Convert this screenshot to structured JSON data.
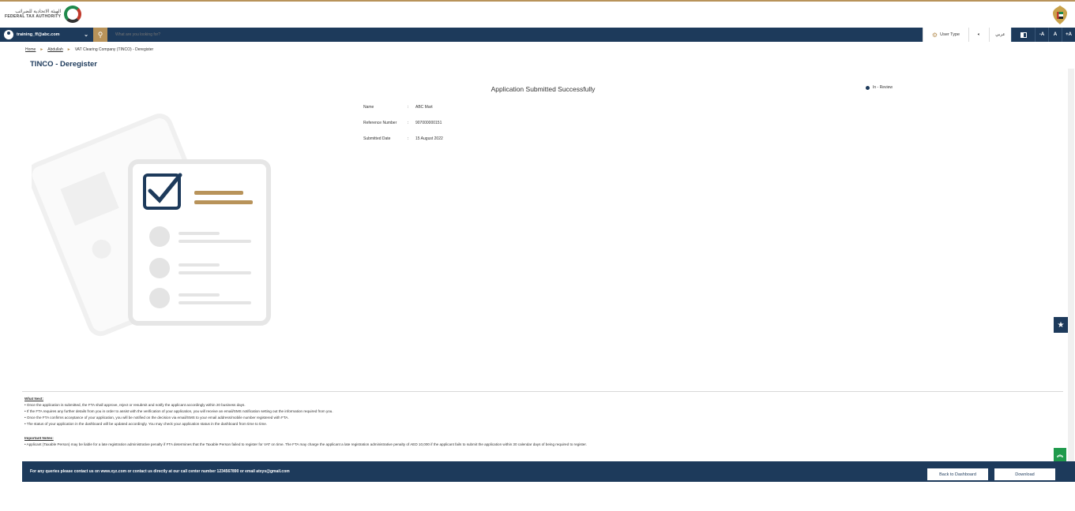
{
  "header": {
    "logo_ar": "الهيئة الاتحادية للضرائب",
    "logo_en": "FEDERAL TAX AUTHORITY"
  },
  "navbar": {
    "user_email": "training_ff@abc.com",
    "search_placeholder": "What are you looking for?",
    "user_type_label": "User Type",
    "language_label": "عربي",
    "font_decrease": "-A",
    "font_normal": "A",
    "font_increase": "+A"
  },
  "breadcrumb": {
    "home": "Home",
    "user": "Abdullah",
    "current": "VAT Clearing Company (TINCO) - Deregister"
  },
  "page_title": "TINCO - Deregister",
  "result": {
    "title": "Application Submitted Successfully",
    "status": "In - Review",
    "details": [
      {
        "label": "Name",
        "value": "ABC Mart"
      },
      {
        "label": "Reference Number",
        "value": "907000000151"
      },
      {
        "label": "Submitted Date",
        "value": "15 August 2022"
      }
    ]
  },
  "what_next": {
    "heading": "What Next:",
    "items": [
      "• Once the application is submitted, the FTA shall approve, reject or resubmit and notify the applicant accordingly within 20 business days.",
      "• If the FTA requires any further details from you in order to assist with the verification of your application, you will receive an email/SMS notification setting out the information required from you.",
      "• Once the FTA confirms acceptance of your application, you will be notified on the decision via email/SMS to your email address/mobile number registered with FTA.",
      "• The status of your application in the dashboard will be updated accordingly. You may check your application status in the dashboard from time to time."
    ]
  },
  "important_notes": {
    "heading": "Important Notes:",
    "items": [
      "• Applicant (Taxable Person) may be liable for a late registration administrative penalty if FTA determines that the Taxable Person failed to register for VAT on time. The FTA may charge the applicant a late registration administrative penalty of AED 10,000 if the applicant fails to submit the application within 30 calendar days of being required to register."
    ]
  },
  "footer": {
    "message": "For any queries please contact us on www.xyz.com or contact us directly at our call center number 1234567890 or email atxys@gmail.com",
    "back_button": "Back to Dashboard",
    "download_button": "Download"
  },
  "colors": {
    "navy": "#1d3a5b",
    "gold": "#b8935a",
    "green": "#1f9a4c"
  }
}
